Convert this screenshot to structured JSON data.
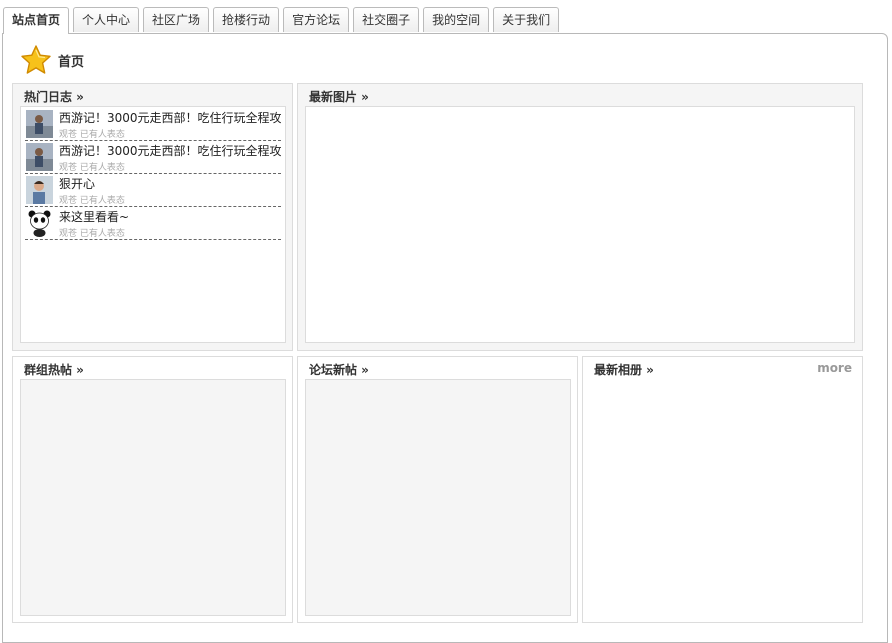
{
  "nav": {
    "tabs": [
      {
        "label": "站点首页",
        "active": true
      },
      {
        "label": "个人中心"
      },
      {
        "label": "社区广场"
      },
      {
        "label": "抢楼行动"
      },
      {
        "label": "官方论坛"
      },
      {
        "label": "社交圈子"
      },
      {
        "label": "我的空间"
      },
      {
        "label": "关于我们"
      }
    ]
  },
  "page": {
    "title": "首页",
    "icon": "star-icon"
  },
  "sections": {
    "hot_blogs": {
      "title": "热门日志 »",
      "posts": [
        {
          "title": "西游记！3000元走西部！吃住行玩全程攻",
          "meta": "观苍  已有人表态",
          "avatar": "traveler-avatar"
        },
        {
          "title": "西游记！3000元走西部！吃住行玩全程攻",
          "meta": "观苍  已有人表态",
          "avatar": "traveler-avatar"
        },
        {
          "title": "狠开心",
          "meta": "观苍  已有人表态",
          "avatar": "man-avatar"
        },
        {
          "title": "来这里看看~",
          "meta": "观苍  已有人表态",
          "avatar": "panda-avatar"
        }
      ]
    },
    "latest_photos": {
      "title": "最新图片 »"
    },
    "group_hot": {
      "title": "群组热帖 »"
    },
    "forum_new": {
      "title": "论坛新帖 »"
    },
    "latest_albums": {
      "title": "最新相册 »",
      "more": "more"
    }
  },
  "colors": {
    "border": "#dcdcdc",
    "panel_bg": "#f5f5f5",
    "star": "#f5b800"
  }
}
